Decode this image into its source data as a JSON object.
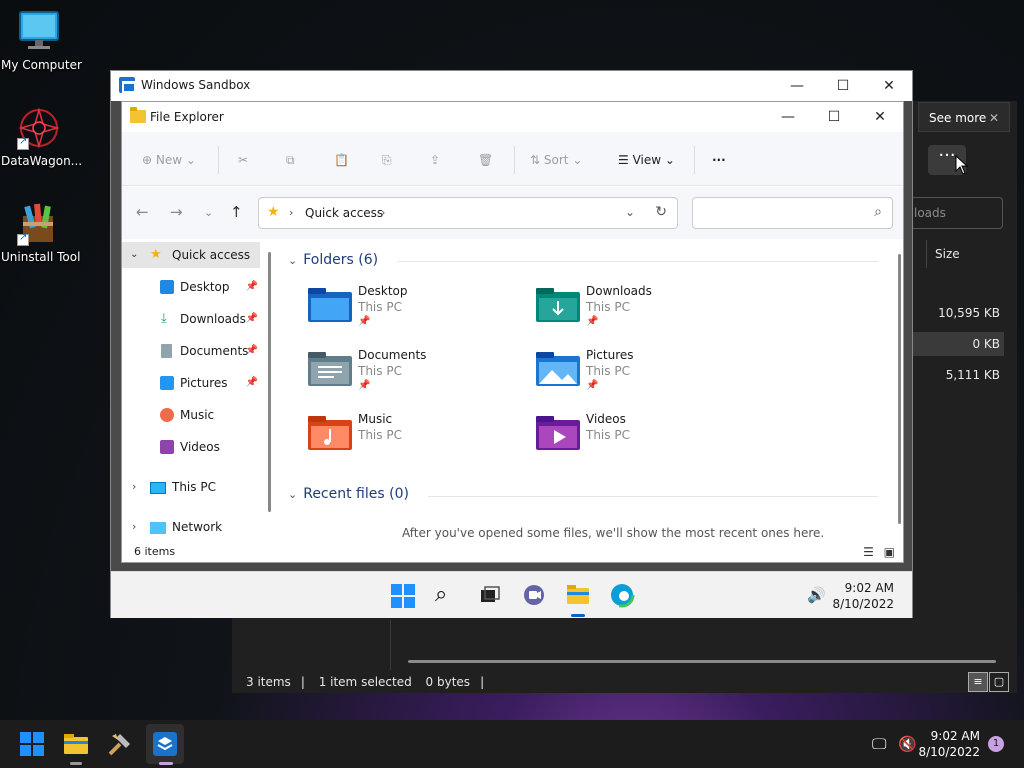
{
  "desktop": {
    "icons": [
      {
        "label": "My Computer",
        "icon": "monitor-icon"
      },
      {
        "label": "DataWagon...",
        "icon": "datawagon-icon"
      },
      {
        "label": "Uninstall Tool",
        "icon": "uninstall-tool-icon"
      }
    ]
  },
  "background_explorer": {
    "see_more_tooltip": "See more",
    "search_placeholder_fragment": "loads",
    "size_header": "Size",
    "sizes": [
      "10,595 KB",
      "0 KB",
      "5,111 KB"
    ],
    "status": {
      "items": "3 items",
      "selected": "1 item selected",
      "size": "0 bytes"
    }
  },
  "sandbox": {
    "title": "Windows Sandbox",
    "taskbar": {
      "time": "9:02 AM",
      "date": "8/10/2022"
    }
  },
  "file_explorer": {
    "title": "File Explorer",
    "toolbar": {
      "new_label": "New",
      "sort_label": "Sort",
      "view_label": "View"
    },
    "address": {
      "crumb": "Quick access"
    },
    "sidebar": {
      "quick_access": "Quick access",
      "items": [
        {
          "label": "Desktop",
          "icon": "desktop-icon",
          "pinned": true
        },
        {
          "label": "Downloads",
          "icon": "download-icon",
          "pinned": true
        },
        {
          "label": "Documents",
          "icon": "documents-icon",
          "pinned": true
        },
        {
          "label": "Pictures",
          "icon": "pictures-icon",
          "pinned": true
        },
        {
          "label": "Music",
          "icon": "music-icon",
          "pinned": false
        },
        {
          "label": "Videos",
          "icon": "videos-icon",
          "pinned": false
        }
      ],
      "this_pc": "This PC",
      "network": "Network"
    },
    "folders_header": "Folders (6)",
    "folders": [
      {
        "name": "Desktop",
        "location": "This PC",
        "pinned": true,
        "color": "#1e88e5"
      },
      {
        "name": "Downloads",
        "location": "This PC",
        "pinned": true,
        "color": "#26a69a"
      },
      {
        "name": "Documents",
        "location": "This PC",
        "pinned": true,
        "color": "#78909c"
      },
      {
        "name": "Pictures",
        "location": "This PC",
        "pinned": true,
        "color": "#2196f3"
      },
      {
        "name": "Music",
        "location": "This PC",
        "pinned": false,
        "color": "#ef6c4a"
      },
      {
        "name": "Videos",
        "location": "This PC",
        "pinned": false,
        "color": "#8e44ad"
      }
    ],
    "recent_header": "Recent files (0)",
    "recent_empty": "After you've opened some files, we'll show the most recent ones here.",
    "status_items": "6 items"
  },
  "host_taskbar": {
    "time": "9:02 AM",
    "date": "8/10/2022",
    "notification_count": "1"
  }
}
